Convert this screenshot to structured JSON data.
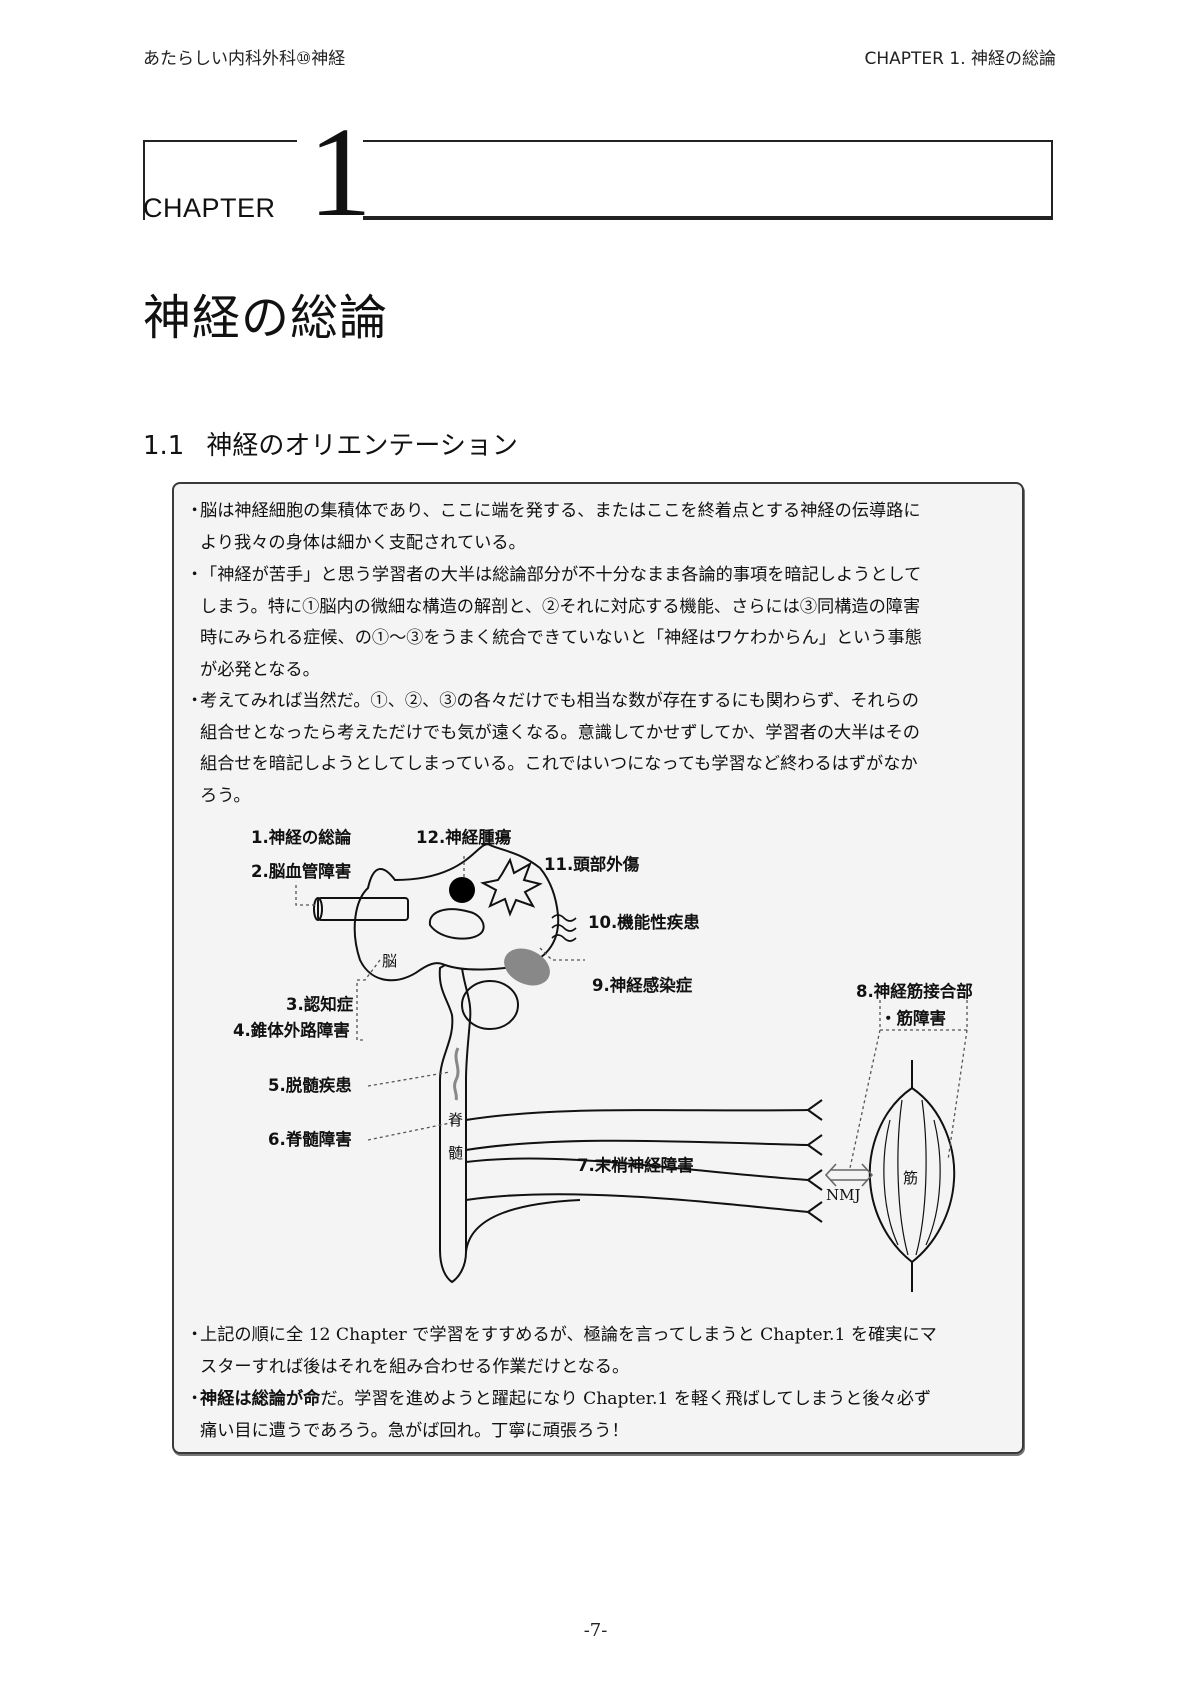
{
  "header": {
    "left": "あたらしい内科外科⑩神経",
    "right": "CHAPTER  1.  神経の総論"
  },
  "chapter": {
    "word": "CHAPTER",
    "number": "1",
    "title": "神経の総論"
  },
  "section": {
    "number": "1.1",
    "title": "神経のオリエンテーション"
  },
  "bullets_top": [
    {
      "lines": [
        "脳は神経細胞の集積体であり、ここに端を発する、またはここを終着点とする神経の伝導路に",
        "より我々の身体は細かく支配されている。"
      ]
    },
    {
      "lines": [
        "「神経が苦手」と思う学習者の大半は総論部分が不十分なまま各論的事項を暗記しようとして",
        "しまう。特に①脳内の微細な構造の解剖と、②それに対応する機能、さらには③同構造の障害",
        "時にみられる症候、の①〜③をうまく統合できていないと「神経はワケわからん」という事態",
        "が必発となる。"
      ]
    },
    {
      "lines": [
        "考えてみれば当然だ。①、②、③の各々だけでも相当な数が存在するにも関わらず、それらの",
        "組合せとなったら考えただけでも気が遠くなる。意識してかせずしてか、学習者の大半はその",
        "組合せを暗記しようとしてしまっている。これではいつになっても学習など終わるはずがなか",
        "ろう。"
      ]
    }
  ],
  "diagram": {
    "labels": {
      "l1": "1.神経の総論",
      "l2": "2.脳血管障害",
      "l3": "3.認知症",
      "l4": "4.錐体外路障害",
      "l5": "5.脱髄疾患",
      "l6": "6.脊髄障害",
      "l7": "7.末梢神経障害",
      "l8a": "8.神経筋接合部",
      "l8b": "・筋障害",
      "l9": "9.神経感染症",
      "l10": "10.機能性疾患",
      "l11": "11.頭部外傷",
      "l12": "12.神経腫瘍"
    },
    "brain": "脳",
    "spinal1": "脊",
    "spinal2": "髄",
    "nmj": "NMJ",
    "muscle": "筋"
  },
  "bullets_bottom": [
    {
      "lines": [
        "上記の順に全 12 Chapter で学習をすすめるが、極論を言ってしまうと Chapter.1 を確実にマ",
        "スターすれば後はそれを組み合わせる作業だけとなる。"
      ]
    },
    {
      "bold": "神経は総論が命",
      "lines": [
        "だ。学習を進めようと躍起になり Chapter.1 を軽く飛ばしてしまうと後々必ず",
        "痛い目に遭うであろう。急がば回れ。丁寧に頑張ろう！"
      ]
    }
  ],
  "page_number": "-7-"
}
